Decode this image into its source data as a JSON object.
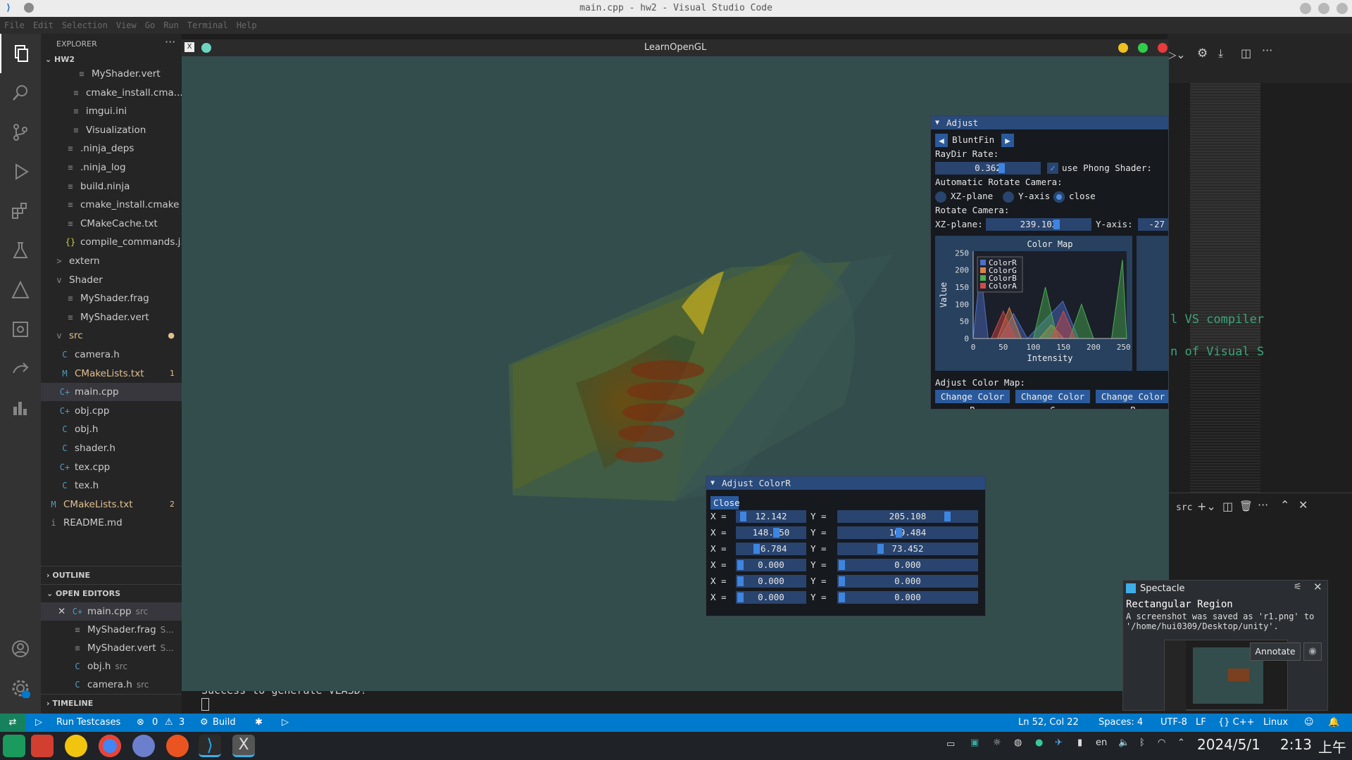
{
  "window": {
    "title": "main.cpp - hw2 - Visual Studio Code"
  },
  "menu": [
    "File",
    "Edit",
    "Selection",
    "View",
    "Go",
    "Run",
    "Terminal",
    "Help"
  ],
  "explorer": {
    "title": "EXPLORER",
    "root": "HW2",
    "items": [
      {
        "label": "MyShader.vert",
        "icon": "≡",
        "color": "#cccccc",
        "badge": ""
      },
      {
        "label": "cmake_install.cma...",
        "icon": "≡",
        "color": "#cccccc",
        "badge": ""
      },
      {
        "label": "imgui.ini",
        "icon": "≡",
        "color": "#cccccc",
        "badge": ""
      },
      {
        "label": "Visualization",
        "icon": "≡",
        "color": "#cccccc",
        "badge": ""
      },
      {
        "label": ".ninja_deps",
        "icon": "≡",
        "color": "#cccccc",
        "badge": ""
      },
      {
        "label": ".ninja_log",
        "icon": "≡",
        "color": "#cccccc",
        "badge": ""
      },
      {
        "label": "build.ninja",
        "icon": "≡",
        "color": "#cccccc",
        "badge": ""
      },
      {
        "label": "cmake_install.cmake",
        "icon": "≡",
        "color": "#cccccc",
        "badge": ""
      },
      {
        "label": "CMakeCache.txt",
        "icon": "≡",
        "color": "#cccccc",
        "badge": ""
      },
      {
        "label": "compile_commands.j...",
        "icon": "{}",
        "color": "#cccccc",
        "badge": ""
      },
      {
        "label": "extern",
        "icon": ">",
        "color": "#cccccc",
        "badge": ""
      },
      {
        "label": "Shader",
        "icon": "v",
        "color": "#cccccc",
        "badge": ""
      },
      {
        "label": "MyShader.frag",
        "icon": "≡",
        "color": "#cccccc",
        "badge": ""
      },
      {
        "label": "MyShader.vert",
        "icon": "≡",
        "color": "#cccccc",
        "badge": ""
      },
      {
        "label": "src",
        "icon": "v",
        "color": "#e2c08d",
        "badge": "●"
      },
      {
        "label": "camera.h",
        "icon": "C",
        "color": "#cccccc",
        "badge": ""
      },
      {
        "label": "CMakeLists.txt",
        "icon": "M",
        "color": "#e2c08d",
        "badge": "1"
      },
      {
        "label": "main.cpp",
        "icon": "C+",
        "color": "#cccccc",
        "badge": ""
      },
      {
        "label": "obj.cpp",
        "icon": "C+",
        "color": "#cccccc",
        "badge": ""
      },
      {
        "label": "obj.h",
        "icon": "C",
        "color": "#cccccc",
        "badge": ""
      },
      {
        "label": "shader.h",
        "icon": "C",
        "color": "#cccccc",
        "badge": ""
      },
      {
        "label": "tex.cpp",
        "icon": "C+",
        "color": "#cccccc",
        "badge": ""
      },
      {
        "label": "tex.h",
        "icon": "C",
        "color": "#cccccc",
        "badge": ""
      },
      {
        "label": "CMakeLists.txt",
        "icon": "M",
        "color": "#e2c08d",
        "badge": "2"
      },
      {
        "label": "README.md",
        "icon": "i",
        "color": "#cccccc",
        "badge": ""
      }
    ],
    "outline": "OUTLINE",
    "open_editors": "OPEN EDITORS",
    "open_items": [
      {
        "label": "main.cpp",
        "hint": "src",
        "icon": "C+"
      },
      {
        "label": "MyShader.frag",
        "hint": "S...",
        "icon": "≡"
      },
      {
        "label": "MyShader.vert",
        "hint": "S...",
        "icon": "≡"
      },
      {
        "label": "obj.h",
        "hint": "src",
        "icon": "C"
      },
      {
        "label": "camera.h",
        "hint": "src",
        "icon": "C"
      }
    ],
    "timeline": "TIMELINE"
  },
  "gl": {
    "title": "LearnOpenGL",
    "adjust": {
      "title": "Adjust",
      "dataset": "BluntFin",
      "raydir_label": "RayDir Rate:",
      "raydir_value": "0.362",
      "phong_label": "use Phong Shader:",
      "auto_rotate_label": "Automatic Rotate Camera:",
      "radio": [
        "XZ-plane",
        "Y-axis",
        "close"
      ],
      "rotate_label": "Rotate Camera:",
      "xz_label": "XZ-plane:",
      "xz_value": "239.103",
      "y_label": "Y-axis:",
      "y_value": "-27",
      "colormap_label": "Adjust Color Map:",
      "buttons": [
        "Change Color R",
        "Change Color G",
        "Change Color B"
      ]
    },
    "chart_data": {
      "type": "area",
      "title": "Color Map",
      "xlabel": "Intensity",
      "ylabel": "Value",
      "xlim": [
        0,
        255
      ],
      "ylim": [
        0,
        255
      ],
      "xticks": [
        0,
        50,
        100,
        150,
        200,
        250
      ],
      "yticks": [
        0,
        50,
        100,
        150,
        200,
        250
      ],
      "series": [
        {
          "name": "ColorR",
          "color": "#4d6fc7",
          "points": [
            [
              0,
              0
            ],
            [
              12,
              205
            ],
            [
              25,
              0
            ],
            [
              45,
              0
            ],
            [
              67,
              73
            ],
            [
              90,
              0
            ],
            [
              149,
              109
            ],
            [
              175,
              0
            ],
            [
              255,
              0
            ]
          ]
        },
        {
          "name": "ColorG",
          "color": "#d9844a",
          "points": [
            [
              0,
              0
            ],
            [
              40,
              0
            ],
            [
              60,
              90
            ],
            [
              80,
              0
            ],
            [
              110,
              0
            ],
            [
              130,
              40
            ],
            [
              150,
              0
            ],
            [
              255,
              0
            ]
          ]
        },
        {
          "name": "ColorB",
          "color": "#4caf50",
          "points": [
            [
              0,
              0
            ],
            [
              100,
              0
            ],
            [
              120,
              150
            ],
            [
              140,
              0
            ],
            [
              160,
              0
            ],
            [
              180,
              100
            ],
            [
              200,
              0
            ],
            [
              230,
              0
            ],
            [
              248,
              230
            ],
            [
              255,
              0
            ]
          ]
        },
        {
          "name": "ColorA",
          "color": "#d24a4a",
          "points": [
            [
              0,
              0
            ],
            [
              30,
              0
            ],
            [
              50,
              80
            ],
            [
              70,
              0
            ],
            [
              130,
              0
            ],
            [
              150,
              80
            ],
            [
              170,
              0
            ],
            [
              255,
              0
            ]
          ]
        }
      ]
    },
    "colorR": {
      "title": "Adjust ColorR",
      "close": "Close",
      "rows": [
        {
          "x": "12.142",
          "y": "205.108",
          "xf": 0.05,
          "yf": 0.8
        },
        {
          "x": "148.750",
          "y": "109.484",
          "xf": 0.58,
          "yf": 0.43
        },
        {
          "x": "66.784",
          "y": "73.452",
          "xf": 0.26,
          "yf": 0.29
        },
        {
          "x": "0.000",
          "y": "0.000",
          "xf": 0.0,
          "yf": 0.0
        },
        {
          "x": "0.000",
          "y": "0.000",
          "xf": 0.0,
          "yf": 0.0
        },
        {
          "x": "0.000",
          "y": "0.000",
          "xf": 0.0,
          "yf": 0.0
        }
      ],
      "xlabel": "X =",
      "ylabel": "Y ="
    }
  },
  "editor_side_text": [
    "l VS compiler",
    "n of Visual S"
  ],
  "terminal": {
    "line": "Success to generate VLASD!",
    "tab": "src"
  },
  "spectacle": {
    "app": "Spectacle",
    "title": "Rectangular Region",
    "body": "A screenshot was saved as 'r1.png' to '/home/hui0309/Desktop/unity'.",
    "annotate": "Annotate"
  },
  "status": {
    "run": "Run Testcases",
    "errors": "0",
    "warnings": "3",
    "build": "Build",
    "position": "Ln 52, Col 22",
    "spaces": "Spaces: 4",
    "encoding": "UTF-8",
    "eol": "LF",
    "language": "{} C++",
    "platform": "Linux"
  },
  "taskbar": {
    "lang": "en",
    "date": "2024/5/1",
    "time": "2:13",
    "ampm": "上午"
  }
}
